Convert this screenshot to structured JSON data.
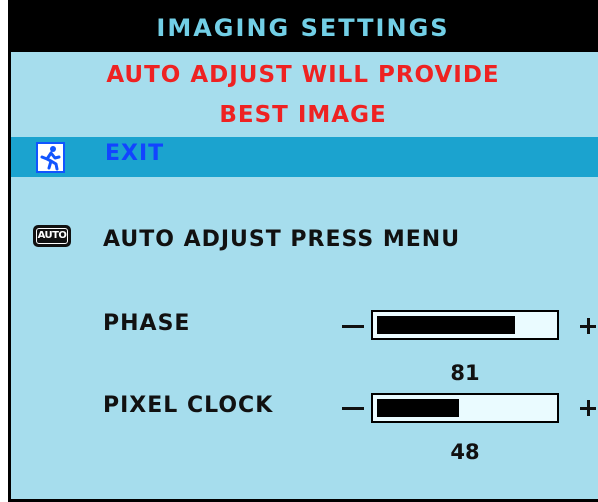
{
  "osd": {
    "title": "IMAGING SETTINGS",
    "hint_line1": "AUTO ADJUST WILL PROVIDE",
    "hint_line2": "BEST IMAGE",
    "colors": {
      "background": "#a6dded",
      "title_bar": "#000000",
      "title_text": "#72cfe6",
      "hint_text": "#ee2222",
      "selected_row": "#1ba3cf",
      "selected_text": "#1244ff"
    },
    "exit": {
      "label": "EXIT",
      "icon": "exit-running-man-icon",
      "selected": true
    },
    "auto_adjust": {
      "label": "AUTO ADJUST PRESS MENU",
      "icon": "auto-icon",
      "icon_text": "AUTO"
    },
    "phase": {
      "label": "PHASE",
      "value": "81",
      "level_percent": 81
    },
    "pixel_clock": {
      "label": "PIXEL CLOCK",
      "value": "48",
      "level_percent": 48
    }
  }
}
